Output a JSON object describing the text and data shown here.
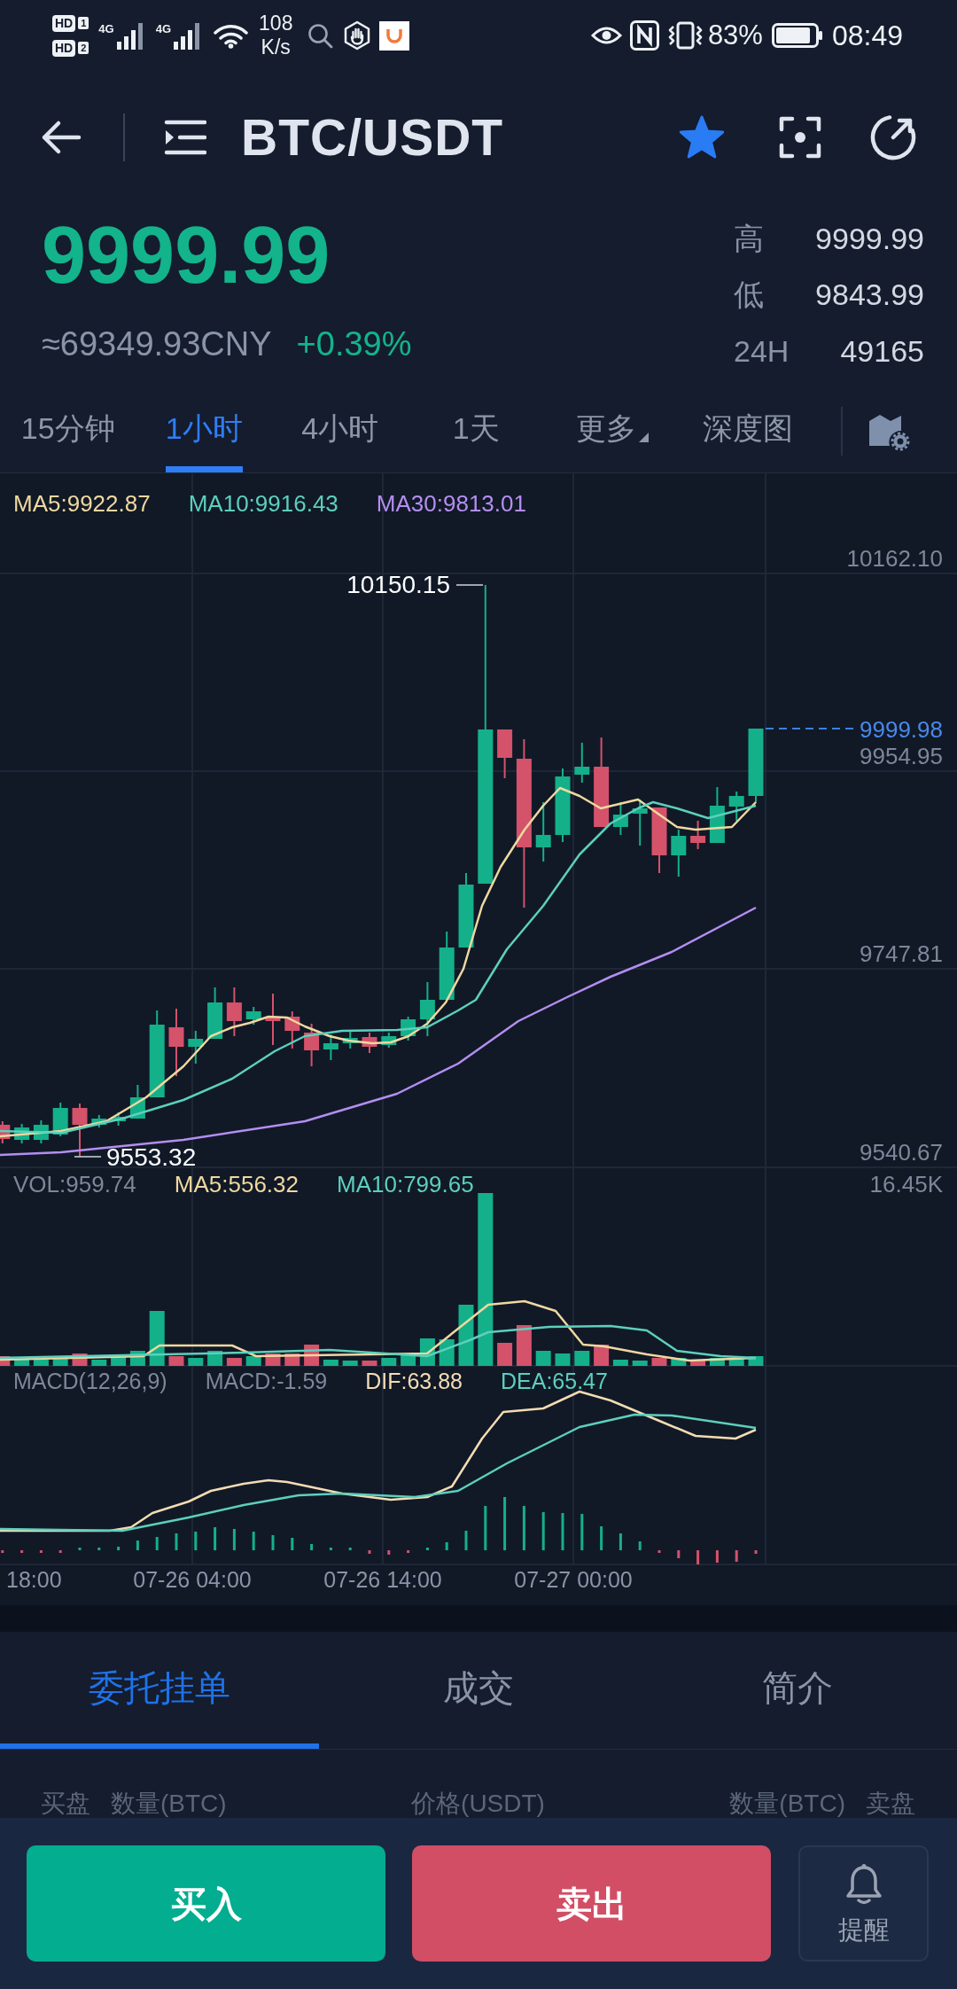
{
  "status_bar": {
    "sims": [
      {
        "badge": "HD",
        "slot": "1"
      },
      {
        "badge": "HD",
        "slot": "2"
      }
    ],
    "networks": [
      {
        "type": "4G"
      },
      {
        "type": "4G"
      }
    ],
    "speed": "108",
    "speed_unit": "K/s",
    "battery": "83%",
    "time": "08:49"
  },
  "header": {
    "title": "BTC/USDT",
    "favorite": true
  },
  "ticker": {
    "price": "9999.99",
    "rising": true,
    "converted": "≈69349.93CNY",
    "change": "+0.39%",
    "stats": [
      {
        "label": "高",
        "value": "9999.99"
      },
      {
        "label": "低",
        "value": "9843.99"
      },
      {
        "label": "24H",
        "value": "49165"
      }
    ]
  },
  "intervals": [
    {
      "label": "15分钟",
      "kind": "option",
      "selected": false
    },
    {
      "label": "1小时",
      "kind": "option",
      "selected": true
    },
    {
      "label": "4小时",
      "kind": "option",
      "selected": false
    },
    {
      "label": "1天",
      "kind": "option",
      "selected": false
    },
    {
      "label": "更多",
      "kind": "dropdown",
      "selected": false
    },
    {
      "label": "深度图",
      "kind": "option",
      "selected": false
    }
  ],
  "chart": {
    "ma_legend": [
      {
        "label": "MA5:9922.87",
        "color": "#efd8a0"
      },
      {
        "label": "MA10:9916.43",
        "color": "#5dcfbd"
      },
      {
        "label": "MA30:9813.01",
        "color": "#b48ef0"
      }
    ],
    "price_ticks": [
      "10162.10",
      "9954.95",
      "9747.81",
      "9540.67"
    ],
    "high_marker": "10150.15",
    "low_marker": "9553.32",
    "last_price": "9999.98",
    "volume_legend": [
      {
        "label": "VOL:959.74",
        "color": "#7e8799"
      },
      {
        "label": "MA5:556.32",
        "color": "#efd8a0"
      },
      {
        "label": "MA10:799.65",
        "color": "#5dcfbd"
      }
    ],
    "volume_max": "16.45K",
    "macd_legend": [
      {
        "label": "MACD(12,26,9)",
        "color": "#7e8799"
      },
      {
        "label": "MACD:-1.59",
        "color": "#7e8799"
      },
      {
        "label": "DIF:63.88",
        "color": "#f3dcb2"
      },
      {
        "label": "DEA:65.47",
        "color": "#5dcfbd"
      }
    ],
    "time_labels": [
      "18:00",
      "07-26 04:00",
      "07-26 14:00",
      "07-27 00:00"
    ]
  },
  "tabs": [
    {
      "label": "委托挂单",
      "selected": true
    },
    {
      "label": "成交",
      "selected": false
    },
    {
      "label": "简介",
      "selected": false
    }
  ],
  "order_book": {
    "bid": "买盘",
    "bid_amount": "数量(BTC)",
    "price": "价格(USDT)",
    "ask_amount": "数量(BTC)",
    "ask": "卖盘"
  },
  "actions": {
    "buy": "买入",
    "sell": "卖出",
    "alert": "提醒"
  }
}
